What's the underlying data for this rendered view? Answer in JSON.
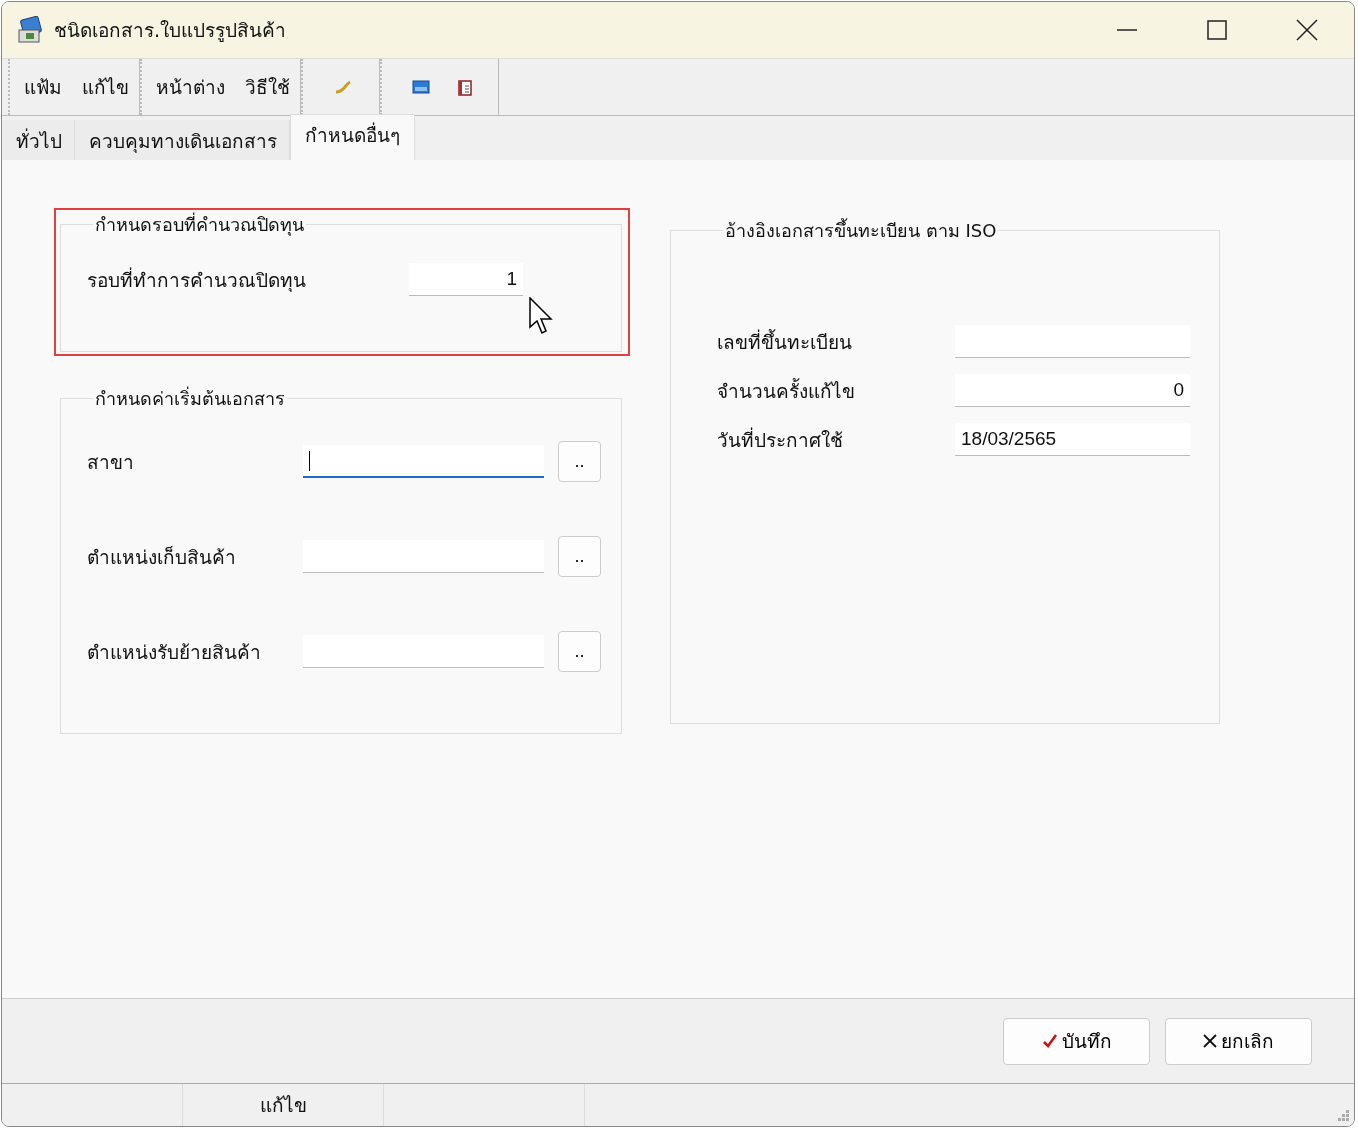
{
  "window": {
    "title": "ชนิดเอกสาร.ใบแปรรูปสินค้า"
  },
  "menu_groups": [
    [
      "แฟ้ม",
      "แก้ไข"
    ],
    [
      "หน้าต่าง",
      "วิธีใช้"
    ]
  ],
  "tabs": [
    {
      "label": "ทั่วไป",
      "selected": false
    },
    {
      "label": "ควบคุมทางเดินเอกสาร",
      "selected": false
    },
    {
      "label": "กำหนดอื่นๆ",
      "selected": true
    }
  ],
  "left_groups": [
    {
      "title": "กำหนดรอบที่คำนวณปิดทุน",
      "highlighted": true,
      "fields": [
        {
          "label": "รอบที่ทำการคำนวณปิดทุน",
          "value": "1",
          "kind": "number",
          "focused": false
        }
      ]
    },
    {
      "title": "กำหนดค่าเริ่มต้นเอกสาร",
      "highlighted": false,
      "fields": [
        {
          "label": "สาขา",
          "kind": "text",
          "focused": true,
          "browse": ".."
        },
        {
          "label": "ตำแหน่งเก็บสินค้า",
          "kind": "text",
          "focused": false,
          "browse": ".."
        },
        {
          "label": "ตำแหน่งรับย้ายสินค้า",
          "kind": "text",
          "focused": false,
          "browse": ".."
        }
      ]
    }
  ],
  "right_group": {
    "title": "อ้างอิงเอกสารขึ้นทะเบียน ตาม ISO",
    "fields": [
      {
        "label": "เลขที่ขึ้นทะเบียน",
        "kind": "text",
        "focused": false
      },
      {
        "label": "จำนวนครั้งแก้ไข",
        "value": "0",
        "kind": "number",
        "focused": false
      },
      {
        "label": "วันที่ประกาศใช้",
        "value": "18/03/2565",
        "kind": "date",
        "focused": false
      }
    ]
  },
  "buttons": [
    {
      "label": "บันทึก",
      "kind": "save"
    },
    {
      "label": "ยกเลิก",
      "kind": "cancel"
    }
  ],
  "status_bar": [
    {
      "text": "แก้ไข"
    }
  ]
}
